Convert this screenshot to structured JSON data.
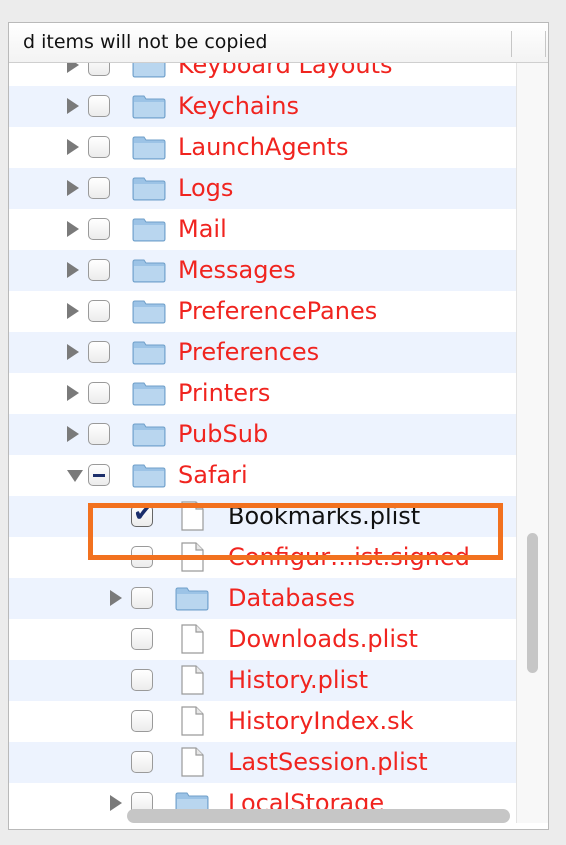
{
  "header": {
    "text": "d items will not be copied"
  },
  "tree": {
    "rows": [
      {
        "label": "Keyboard Layouts",
        "kind": "folder",
        "expandable": true,
        "state": "unchecked",
        "level": 0,
        "color": "red"
      },
      {
        "label": "Keychains",
        "kind": "folder",
        "expandable": true,
        "state": "unchecked",
        "level": 0,
        "color": "red"
      },
      {
        "label": "LaunchAgents",
        "kind": "folder",
        "expandable": true,
        "state": "unchecked",
        "level": 0,
        "color": "red"
      },
      {
        "label": "Logs",
        "kind": "folder",
        "expandable": true,
        "state": "unchecked",
        "level": 0,
        "color": "red"
      },
      {
        "label": "Mail",
        "kind": "folder",
        "expandable": true,
        "state": "unchecked",
        "level": 0,
        "color": "red"
      },
      {
        "label": "Messages",
        "kind": "folder",
        "expandable": true,
        "state": "unchecked",
        "level": 0,
        "color": "red"
      },
      {
        "label": "PreferencePanes",
        "kind": "folder",
        "expandable": true,
        "state": "unchecked",
        "level": 0,
        "color": "red"
      },
      {
        "label": "Preferences",
        "kind": "folder",
        "expandable": true,
        "state": "unchecked",
        "level": 0,
        "color": "red"
      },
      {
        "label": "Printers",
        "kind": "folder",
        "expandable": true,
        "state": "unchecked",
        "level": 0,
        "color": "red"
      },
      {
        "label": "PubSub",
        "kind": "folder",
        "expandable": true,
        "state": "unchecked",
        "level": 0,
        "color": "red"
      },
      {
        "label": "Safari",
        "kind": "folder",
        "expandable": true,
        "expanded": true,
        "state": "mixed",
        "level": 0,
        "color": "red"
      },
      {
        "label": "Bookmarks.plist",
        "kind": "file",
        "expandable": false,
        "state": "checked",
        "level": 1,
        "color": "black",
        "highlighted": true
      },
      {
        "label": "Configur…ist.signed",
        "kind": "file",
        "expandable": false,
        "state": "unchecked",
        "level": 1,
        "color": "red"
      },
      {
        "label": "Databases",
        "kind": "folder",
        "expandable": true,
        "state": "unchecked",
        "level": 1,
        "color": "red"
      },
      {
        "label": "Downloads.plist",
        "kind": "file",
        "expandable": false,
        "state": "unchecked",
        "level": 1,
        "color": "red"
      },
      {
        "label": "History.plist",
        "kind": "file",
        "expandable": false,
        "state": "unchecked",
        "level": 1,
        "color": "red"
      },
      {
        "label": "HistoryIndex.sk",
        "kind": "file",
        "expandable": false,
        "state": "unchecked",
        "level": 1,
        "color": "red"
      },
      {
        "label": "LastSession.plist",
        "kind": "file",
        "expandable": false,
        "state": "unchecked",
        "level": 1,
        "color": "red"
      },
      {
        "label": "LocalStorage",
        "kind": "folder",
        "expandable": true,
        "state": "unchecked",
        "level": 1,
        "color": "red"
      }
    ]
  },
  "colors": {
    "label_red": "#f0241f",
    "highlight_orange": "#f2711f",
    "row_alt": "#edf3fe",
    "folder_blue": "#9cc3e6"
  },
  "icons": {
    "expand": "disclosure-triangle-right-icon",
    "collapse": "disclosure-triangle-down-icon",
    "folder": "folder-icon",
    "file": "document-icon"
  },
  "scroll": {
    "vertical_position": 0.62,
    "horizontal_position": 0.22
  }
}
